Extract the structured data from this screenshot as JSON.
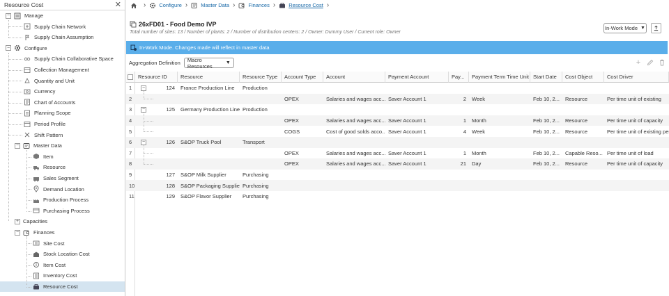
{
  "left_panel": {
    "title": "Resource Cost",
    "close_glyph": "✕",
    "tree": [
      {
        "label": "Manage",
        "level": 0,
        "toggle": "−",
        "icon": "list-icon"
      },
      {
        "label": "Supply Chain Network",
        "level": 1,
        "icon": "network-icon"
      },
      {
        "label": "Supply Chain Assumption",
        "level": 1,
        "icon": "assumption-icon"
      },
      {
        "label": "Configure",
        "level": 0,
        "toggle": "−",
        "icon": "gear-icon"
      },
      {
        "label": "Supply Chain Collaborative Space",
        "level": 1,
        "icon": "collab-icon"
      },
      {
        "label": "Collection Management",
        "level": 1,
        "icon": "collection-icon"
      },
      {
        "label": "Quantity and Unit",
        "level": 1,
        "icon": "quantity-icon"
      },
      {
        "label": "Currency",
        "level": 1,
        "icon": "currency-icon"
      },
      {
        "label": "Chart of Accounts",
        "level": 1,
        "icon": "accounts-icon"
      },
      {
        "label": "Planning Scope",
        "level": 1,
        "icon": "scope-icon"
      },
      {
        "label": "Period Profile",
        "level": 1,
        "icon": "period-icon"
      },
      {
        "label": "Shift Pattern",
        "level": 1,
        "icon": "shift-icon"
      },
      {
        "label": "Master Data",
        "level": 1,
        "toggle": "−",
        "icon": "master-data-icon"
      },
      {
        "label": "Item",
        "level": 2,
        "icon": "item-icon"
      },
      {
        "label": "Resource",
        "level": 2,
        "icon": "truck-icon"
      },
      {
        "label": "Sales Segment",
        "level": 2,
        "icon": "segment-icon"
      },
      {
        "label": "Demand Location",
        "level": 2,
        "icon": "location-icon"
      },
      {
        "label": "Production Process",
        "level": 2,
        "icon": "factory-icon"
      },
      {
        "label": "Purchasing Process",
        "level": 2,
        "icon": "purchase-icon"
      },
      {
        "label": "Capacities",
        "level": 1,
        "toggle": "+",
        "icon": ""
      },
      {
        "label": "Finances",
        "level": 1,
        "toggle": "−",
        "icon": "finances-icon"
      },
      {
        "label": "Site Cost",
        "level": 2,
        "icon": "site-cost-icon"
      },
      {
        "label": "Stock Location Cost",
        "level": 2,
        "icon": "stock-cost-icon"
      },
      {
        "label": "Item Cost",
        "level": 2,
        "icon": "item-cost-icon"
      },
      {
        "label": "Inventory Cost",
        "level": 2,
        "icon": "inventory-cost-icon"
      },
      {
        "label": "Resource Cost",
        "level": 2,
        "icon": "resource-cost-icon",
        "selected": true
      }
    ]
  },
  "breadcrumb": {
    "items": [
      "Configure",
      "Master Data",
      "Finances",
      "Resource Cost"
    ]
  },
  "header": {
    "title": "26xFD01 - Food Demo IVP",
    "subtitle": "Total number of sites: 13 / Number of plants: 2 / Number of distribution centers: 2 / Owner: Dummy User / Current role: Owner",
    "mode_label": "In-Work Mode"
  },
  "banner": {
    "text": "In-Work Mode. Changes made will reflect in master data",
    "color": "#5aaeea"
  },
  "aggregation": {
    "label": "Aggregation Definition",
    "value": "Macro Resources"
  },
  "grid": {
    "columns": [
      "Resource ID",
      "Resource",
      "Resource Type",
      "Account Type",
      "Account",
      "Payment Account",
      "Pay...",
      "Payment Term Time Unit",
      "Start Date",
      "Cost Object",
      "Cost Driver"
    ],
    "rows": [
      {
        "n": "1",
        "toggle": "−",
        "id": "124",
        "resource": "France Production Line",
        "type": "Production",
        "acct_type": "",
        "account": "",
        "pay_acct": "",
        "pay": "",
        "unit": "",
        "start": "",
        "cost_obj": "",
        "driver": ""
      },
      {
        "n": "2",
        "child": true,
        "id": "",
        "resource": "",
        "type": "",
        "acct_type": "OPEX",
        "account": "Salaries and wages acc...",
        "pay_acct": "Saver Account 1",
        "pay": "2",
        "unit": "Week",
        "start": "Feb 10, 2...",
        "cost_obj": "Resource",
        "driver": "Per time unit of existing"
      },
      {
        "n": "3",
        "toggle": "−",
        "id": "125",
        "resource": "Germany Production Line",
        "type": "Production",
        "acct_type": "",
        "account": "",
        "pay_acct": "",
        "pay": "",
        "unit": "",
        "start": "",
        "cost_obj": "",
        "driver": ""
      },
      {
        "n": "4",
        "child": true,
        "id": "",
        "resource": "",
        "type": "",
        "acct_type": "OPEX",
        "account": "Salaries and wages acc...",
        "pay_acct": "Saver Account 1",
        "pay": "1",
        "unit": "Month",
        "start": "Feb 10, 2...",
        "cost_obj": "Resource",
        "driver": "Per time unit of capacity"
      },
      {
        "n": "5",
        "child": true,
        "id": "",
        "resource": "",
        "type": "",
        "acct_type": "COGS",
        "account": "Cost of good solds acco...",
        "pay_acct": "Saver Account 1",
        "pay": "4",
        "unit": "Week",
        "start": "Feb 10, 2...",
        "cost_obj": "Resource",
        "driver": "Per time unit of existing per"
      },
      {
        "n": "6",
        "toggle": "−",
        "id": "126",
        "resource": "S&OP Truck Pool",
        "type": "Transport",
        "acct_type": "",
        "account": "",
        "pay_acct": "",
        "pay": "",
        "unit": "",
        "start": "",
        "cost_obj": "",
        "driver": ""
      },
      {
        "n": "7",
        "child": true,
        "id": "",
        "resource": "",
        "type": "",
        "acct_type": "OPEX",
        "account": "Salaries and wages acc...",
        "pay_acct": "Saver Account 1",
        "pay": "1",
        "unit": "Month",
        "start": "Feb 10, 2...",
        "cost_obj": "Capable Reso...",
        "driver": "Per time unit of load"
      },
      {
        "n": "8",
        "child": true,
        "id": "",
        "resource": "",
        "type": "",
        "acct_type": "OPEX",
        "account": "Salaries and wages acc...",
        "pay_acct": "Saver Account 1",
        "pay": "21",
        "unit": "Day",
        "start": "Feb 10, 2...",
        "cost_obj": "Resource",
        "driver": "Per time unit of capacity"
      },
      {
        "n": "9",
        "id": "127",
        "resource": "S&OP Milk Supplier",
        "type": "Purchasing",
        "acct_type": "",
        "account": "",
        "pay_acct": "",
        "pay": "",
        "unit": "",
        "start": "",
        "cost_obj": "",
        "driver": ""
      },
      {
        "n": "10",
        "id": "128",
        "resource": "S&OP Packaging Supplier",
        "type": "Purchasing",
        "acct_type": "",
        "account": "",
        "pay_acct": "",
        "pay": "",
        "unit": "",
        "start": "",
        "cost_obj": "",
        "driver": ""
      },
      {
        "n": "11",
        "id": "129",
        "resource": "S&OP Flavor Supplier",
        "type": "Purchasing",
        "acct_type": "",
        "account": "",
        "pay_acct": "",
        "pay": "",
        "unit": "",
        "start": "",
        "cost_obj": "",
        "driver": ""
      }
    ]
  }
}
